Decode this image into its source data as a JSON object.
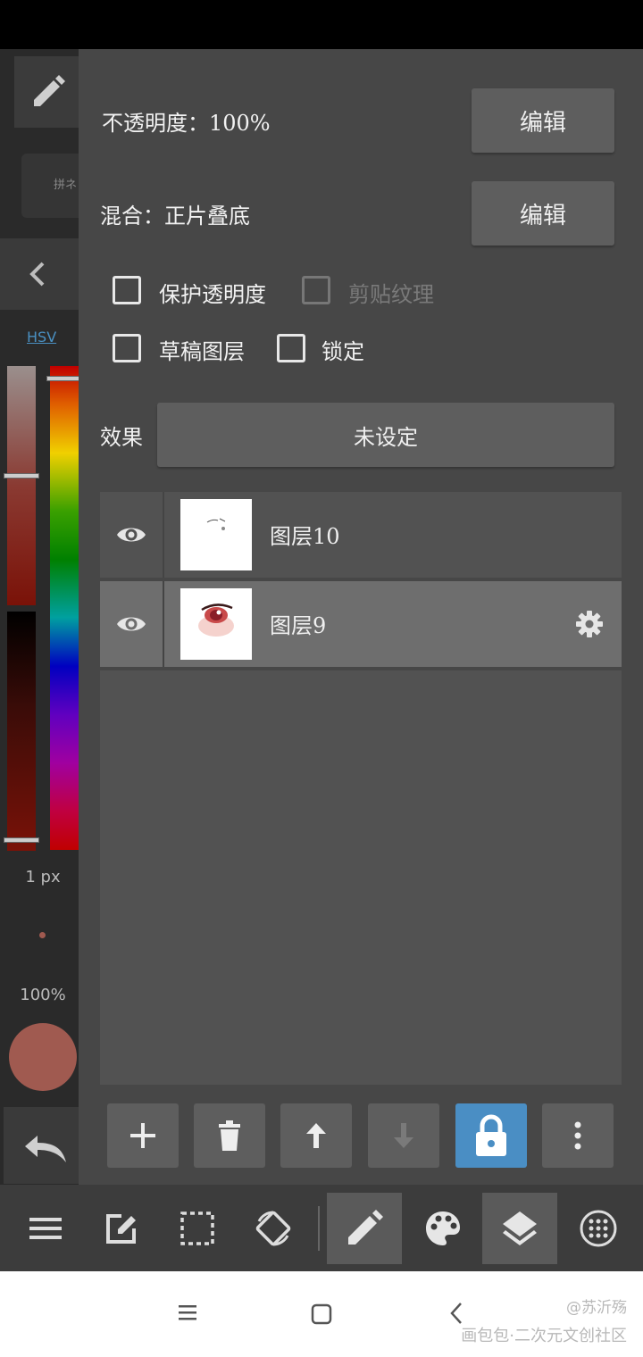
{
  "left_tools": {
    "brush_preview_text": "拼ネ",
    "color_mode": "HSV",
    "brush_size": "1 px",
    "brush_opacity": "100%"
  },
  "layer_panel": {
    "opacity_label": "不透明度：100%",
    "blend_label": "混合：正片叠底",
    "edit_label": "编辑",
    "checkboxes": [
      {
        "label": "保护透明度",
        "checked": false,
        "enabled": true
      },
      {
        "label": "剪贴纹理",
        "checked": false,
        "enabled": false
      },
      {
        "label": "草稿图层",
        "checked": false,
        "enabled": true
      },
      {
        "label": "锁定",
        "checked": false,
        "enabled": true
      }
    ],
    "effect_label": "效果",
    "effect_value": "未设定",
    "layers": [
      {
        "name": "图层10",
        "visible": true,
        "selected": false
      },
      {
        "name": "图层9",
        "visible": true,
        "selected": true
      }
    ]
  },
  "layer_tools": [
    "add",
    "delete",
    "move-up",
    "move-down",
    "lock",
    "more"
  ],
  "bottom_toolbar": [
    "menu",
    "edit",
    "selection",
    "rotate",
    "pen",
    "palette",
    "layers",
    "grid"
  ],
  "watermark": {
    "user": "@苏沂殇",
    "site": "画包包·二次元文创社区"
  },
  "colors": {
    "accent": "#4a8ec4",
    "current_color": "#a05a50"
  }
}
